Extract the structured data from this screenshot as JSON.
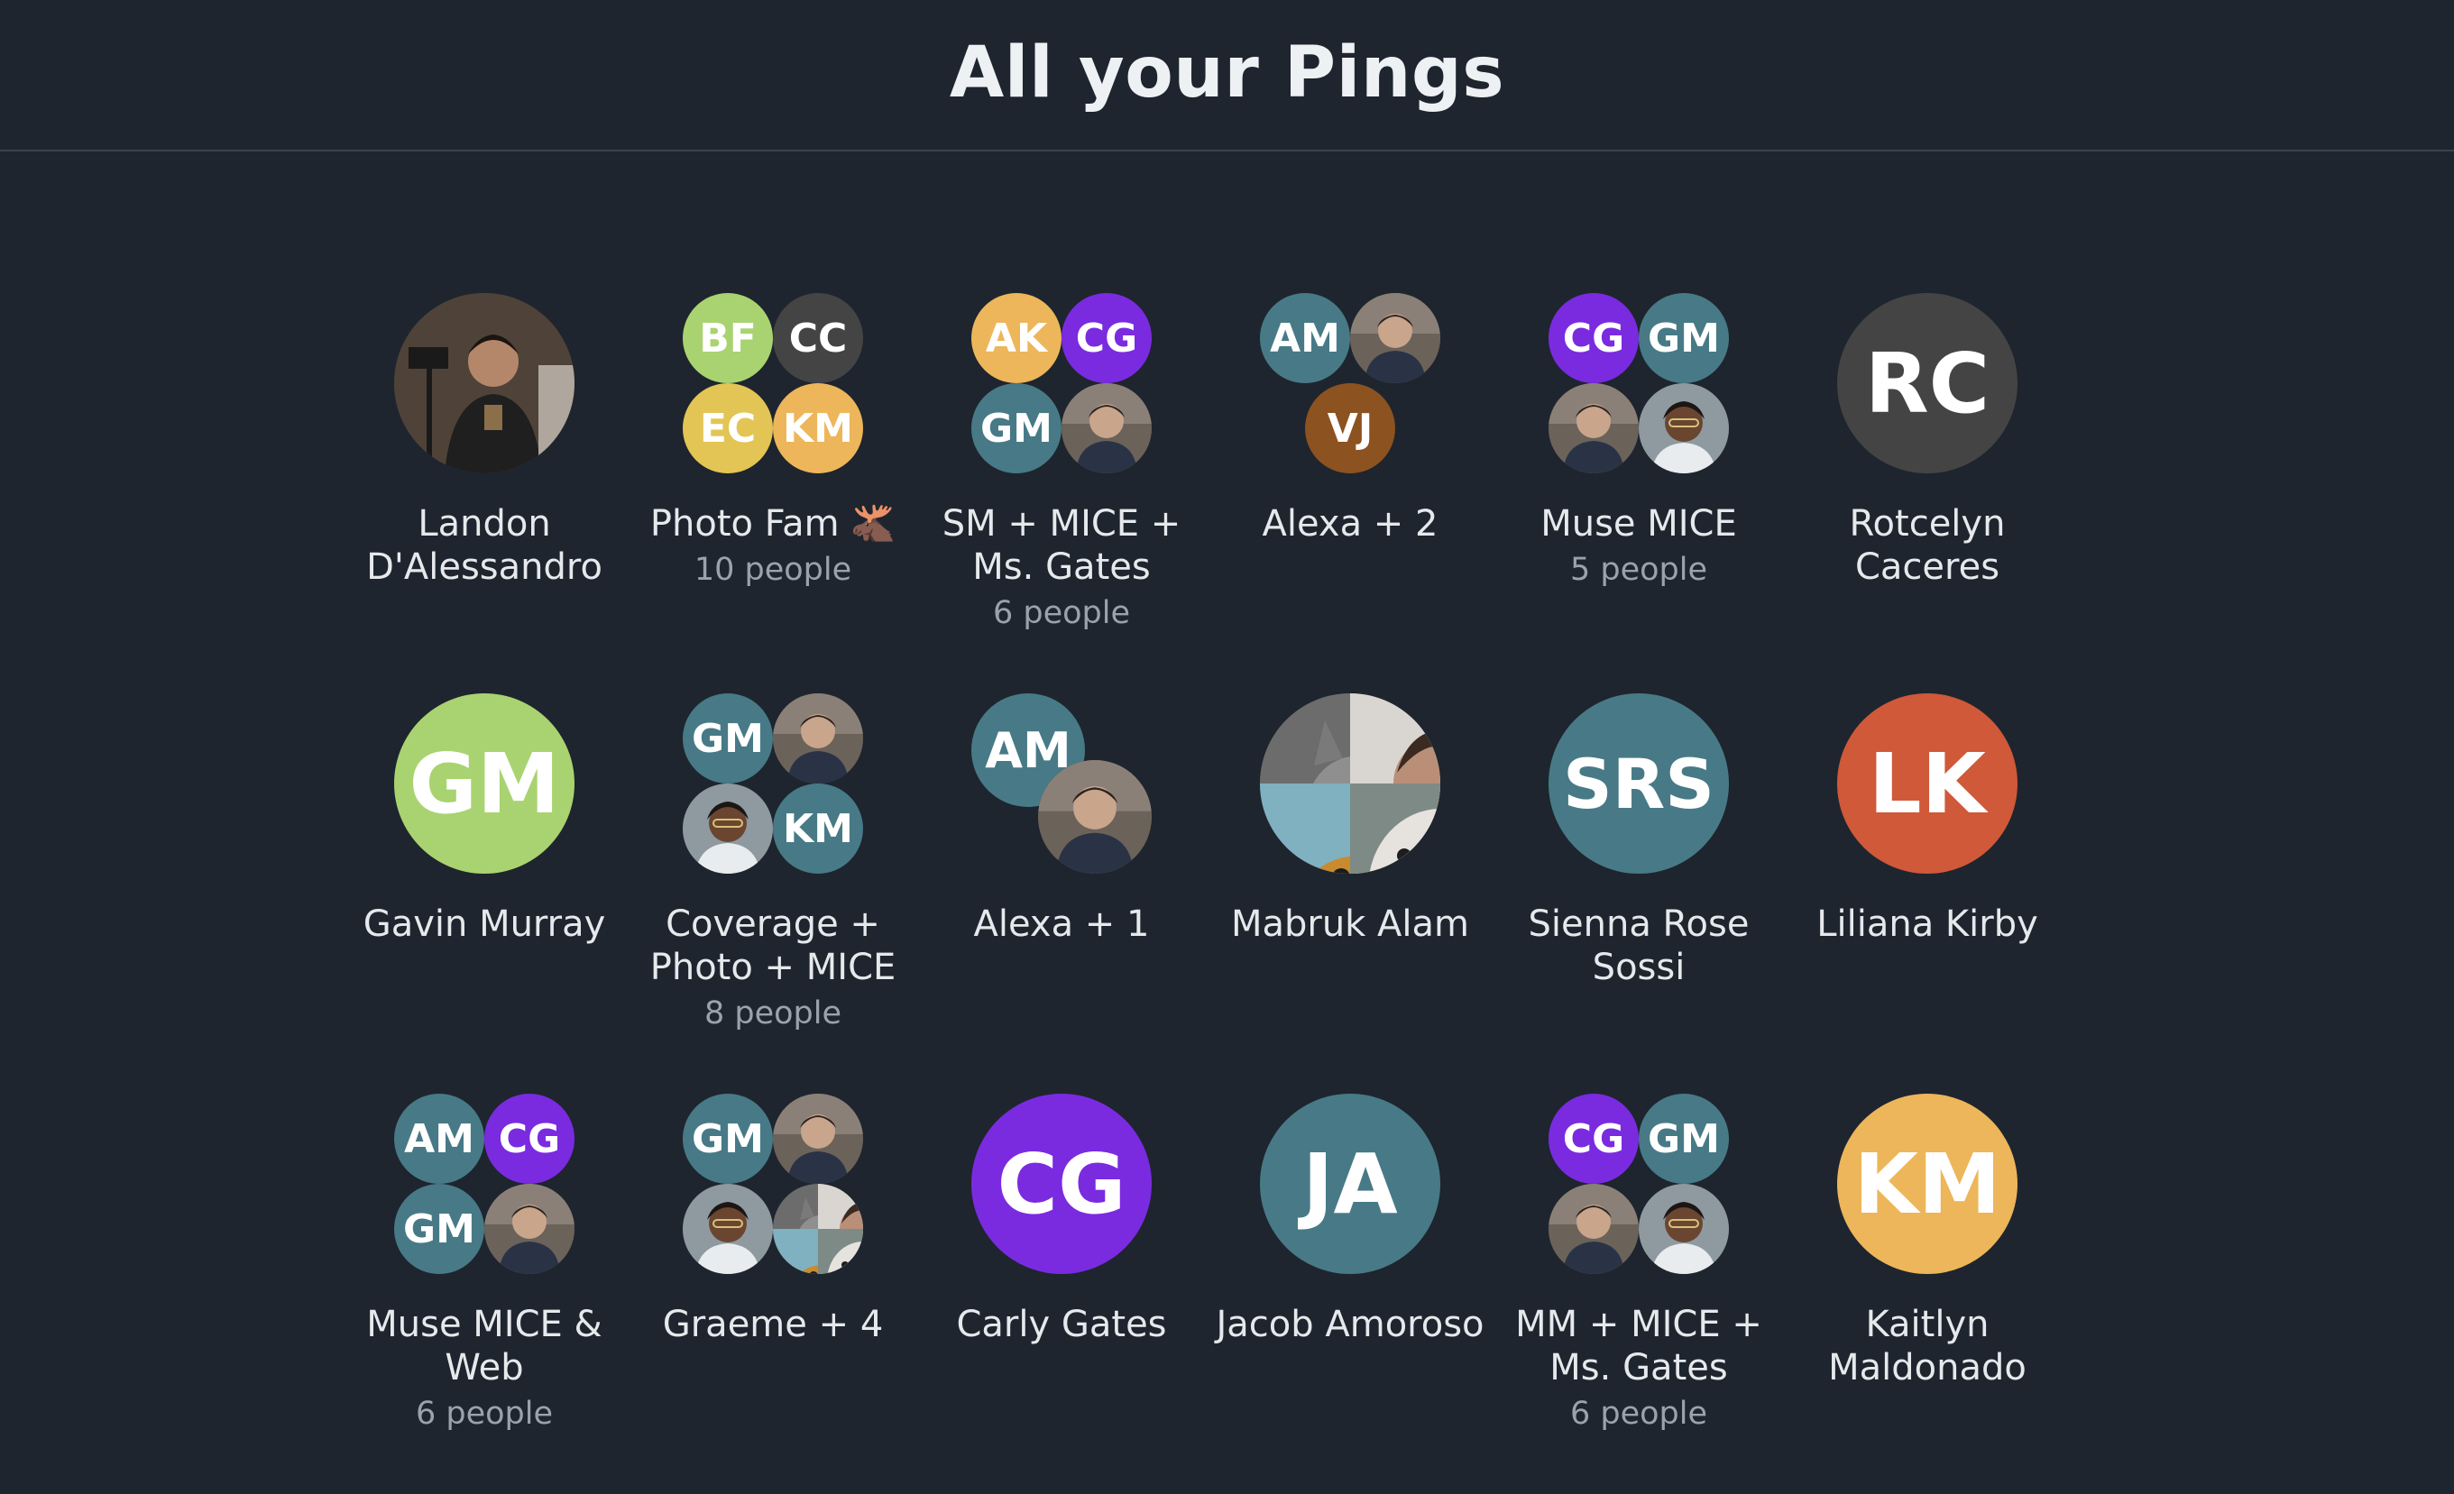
{
  "header": {
    "title": "All your Pings"
  },
  "colors": {
    "green": "#a9d370",
    "gray": "#444444",
    "yellow": "#e2c554",
    "orange": "#edb65a",
    "purple": "#7a2be0",
    "teal": "#477a86",
    "brown": "#8c5220",
    "red": "#cf5939"
  },
  "pings": [
    {
      "name": "Landon D'Alessandro",
      "subtitle": ""
    },
    {
      "name": "Photo Fam 🫎",
      "subtitle": "10 people",
      "initials": [
        "BF",
        "CC",
        "EC",
        "KM"
      ]
    },
    {
      "name": "SM + MICE + Ms. Gates",
      "subtitle": "6 people",
      "initials": [
        "AK",
        "CG",
        "GM"
      ]
    },
    {
      "name": "Alexa + 2",
      "subtitle": "",
      "initials": [
        "AM",
        "VJ"
      ]
    },
    {
      "name": "Muse MICE",
      "subtitle": "5 people",
      "initials": [
        "CG",
        "GM"
      ]
    },
    {
      "name": "Rotcelyn Caceres",
      "subtitle": "",
      "initials": [
        "RC"
      ]
    },
    {
      "name": "Gavin Murray",
      "subtitle": "",
      "initials": [
        "GM"
      ]
    },
    {
      "name": "Coverage + Photo + MICE",
      "subtitle": "8 people",
      "initials": [
        "GM",
        "KM"
      ]
    },
    {
      "name": "Alexa + 1",
      "subtitle": "",
      "initials": [
        "AM"
      ]
    },
    {
      "name": "Mabruk Alam",
      "subtitle": ""
    },
    {
      "name": "Sienna Rose Sossi",
      "subtitle": "",
      "initials": [
        "SRS"
      ]
    },
    {
      "name": "Liliana Kirby",
      "subtitle": "",
      "initials": [
        "LK"
      ]
    },
    {
      "name": "Muse MICE & Web",
      "subtitle": "6 people",
      "initials": [
        "AM",
        "CG",
        "GM"
      ]
    },
    {
      "name": "Graeme + 4",
      "subtitle": "",
      "initials": [
        "GM"
      ]
    },
    {
      "name": "Carly Gates",
      "subtitle": "",
      "initials": [
        "CG"
      ]
    },
    {
      "name": "Jacob Amoroso",
      "subtitle": "",
      "initials": [
        "JA"
      ]
    },
    {
      "name": "MM + MICE + Ms. Gates",
      "subtitle": "6 people",
      "initials": [
        "CG",
        "GM"
      ]
    },
    {
      "name": "Kaitlyn Maldonado",
      "subtitle": "",
      "initials": [
        "KM"
      ]
    }
  ]
}
